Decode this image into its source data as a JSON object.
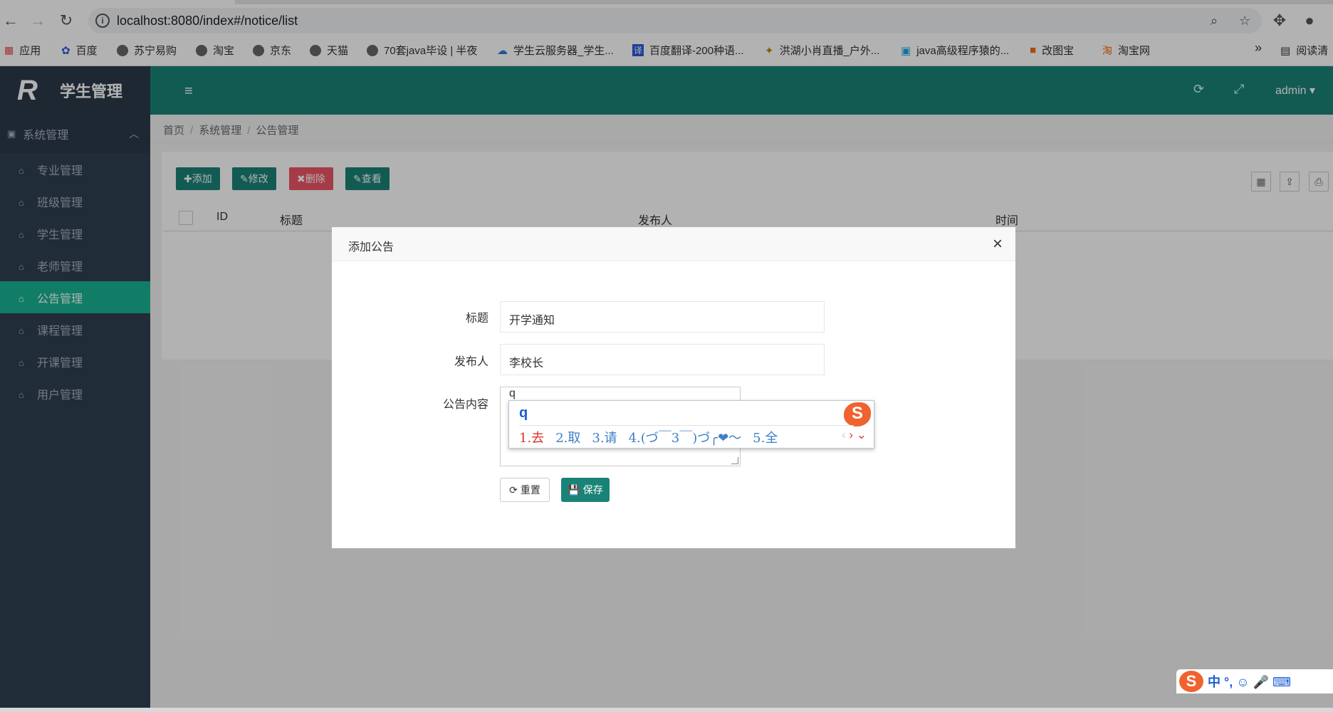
{
  "browser": {
    "url": "localhost:8080/index#/notice/list",
    "bookmarks": [
      "应用",
      "百度",
      "苏宁易购",
      "淘宝",
      "京东",
      "天猫",
      "70套java毕设 | 半夜",
      "学生云服务器_学生...",
      "百度翻译-200种语...",
      "洪湖小肖直播_户外...",
      "java高级程序猿的...",
      "改图宝",
      "淘宝网"
    ],
    "more": "»",
    "reading_list": "阅读清"
  },
  "app": {
    "title": "学生管理",
    "logo_mark": "R",
    "user": "admin ▾",
    "menu_group": "系统管理",
    "menu": [
      {
        "label": "专业管理",
        "active": false
      },
      {
        "label": "班级管理",
        "active": false
      },
      {
        "label": "学生管理",
        "active": false
      },
      {
        "label": "老师管理",
        "active": false
      },
      {
        "label": "公告管理",
        "active": true
      },
      {
        "label": "课程管理",
        "active": false
      },
      {
        "label": "开课管理",
        "active": false
      },
      {
        "label": "用户管理",
        "active": false
      }
    ],
    "breadcrumb": [
      "首页",
      "系统管理",
      "公告管理"
    ]
  },
  "toolbar": {
    "add": "添加",
    "edit": "修改",
    "delete": "删除",
    "view": "查看"
  },
  "table": {
    "columns": [
      "ID",
      "标题",
      "发布人",
      "时间"
    ]
  },
  "modal": {
    "title": "添加公告",
    "close": "×",
    "fields": {
      "title_label": "标题",
      "title_value": "开学通知",
      "publisher_label": "发布人",
      "publisher_value": "李校长",
      "content_label": "公告内容",
      "content_value": "q"
    },
    "reset": "重置",
    "save": "保存"
  },
  "ime": {
    "composition": "q",
    "candidates": [
      "1.去",
      "2.取",
      "3.请",
      "4.(づ￣3￣)づ╭❤～",
      "5.全"
    ],
    "logo": "S",
    "tray_text": "中 °, ☺ 🎤 ⌨"
  },
  "colors": {
    "sidebar": "#2f4050",
    "topbar": "#1a8377",
    "active": "#1ab394",
    "btn_add": "#1a8377",
    "btn_delete": "#ed5565"
  }
}
